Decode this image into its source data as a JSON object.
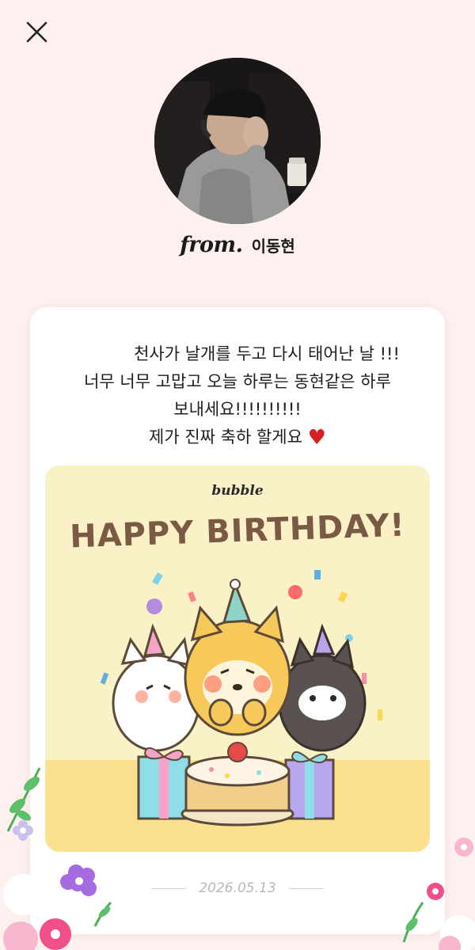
{
  "header": {
    "close_icon": "close-icon"
  },
  "sender": {
    "from_prefix": "from.",
    "name": "이동현"
  },
  "message": {
    "lines": [
      "천사가 날개를 두고 다시 태어난 날 !!!",
      "너무 너무 고맙고 오늘 하루는 동현같은 하루",
      "보내세요!!!!!!!!!!",
      "제가 진짜 축하 할게요"
    ],
    "heart_icon": "heart-icon",
    "heart_glyph": "♥"
  },
  "birthday_card": {
    "brand": "bubble",
    "title": "HAPPY BIRTHDAY!"
  },
  "footer": {
    "date": "2026.05.13"
  },
  "colors": {
    "background": "#fdf0ef",
    "card": "#ffffff",
    "birthday_card_bg": "#faf1c6",
    "title_brown": "#7a5a45",
    "heart": "#d42020",
    "date_gray": "#b9b9b9"
  }
}
